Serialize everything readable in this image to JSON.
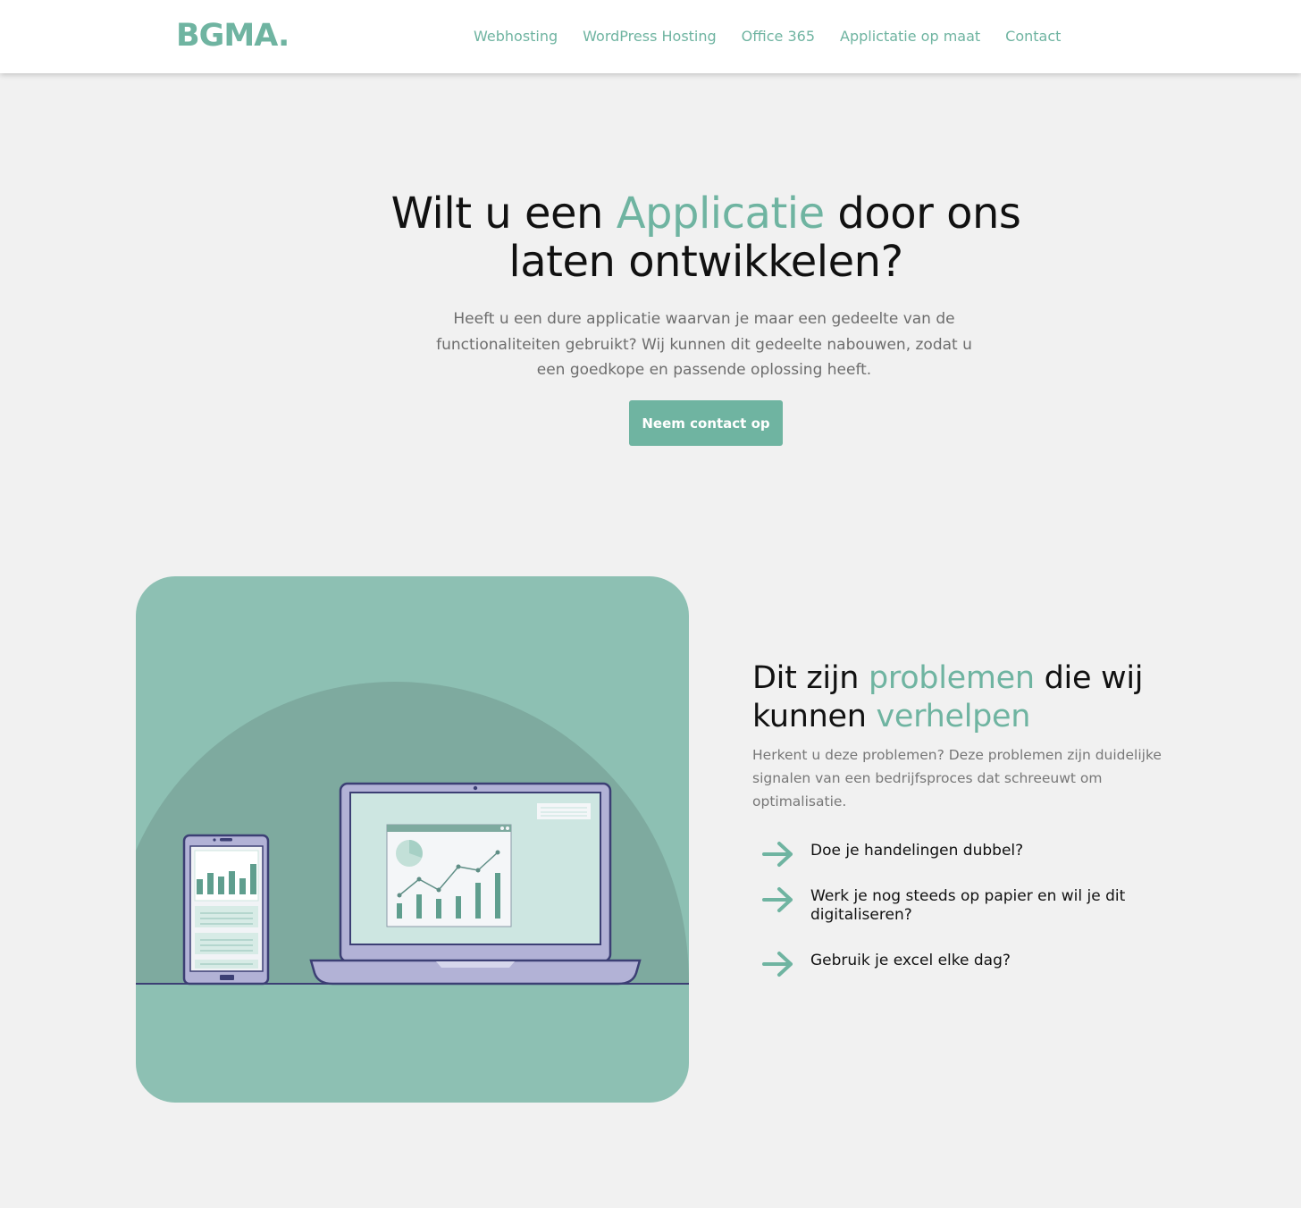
{
  "header": {
    "logo": "BGMA.",
    "nav": [
      "Webhosting",
      "WordPress Hosting",
      "Office 365",
      "Applictatie op maat",
      "Contact"
    ]
  },
  "hero": {
    "title_part1": "Wilt u een ",
    "title_accent": "Applicatie",
    "title_part2": " door ons laten ontwikkelen?",
    "text": "Heeft u een dure applicatie waarvan je maar een gedeelte van de functionaliteiten gebruikt? Wij kunnen dit gedeelte nabouwen, zodat u een goedkope en passende oplossing heeft.",
    "cta_label": "Neem contact op"
  },
  "problems": {
    "title_part1": "Dit zijn ",
    "title_accent1": "problemen",
    "title_part2": " die wij kunnen ",
    "title_accent2": "verhelpen",
    "text": "Herkent u deze problemen? Deze problemen zijn duidelijke signalen van een bedrijfsproces dat schreeuwt om optimalisatie.",
    "items": [
      "Doe je handelingen dubbel?",
      "Werk je nog steeds op papier en wil je dit digitaliseren?",
      "Gebruik je excel elke dag?"
    ]
  },
  "icons": {
    "list_arrow": "arrow-right-icon"
  },
  "colors": {
    "accent": "#6fb4a1",
    "card_bg": "#8dc0b3",
    "card_dome": "#7eaa9f",
    "device_frame": "#b2b2d6",
    "device_stroke": "#3c3f74",
    "background": "#f1f1f1"
  }
}
